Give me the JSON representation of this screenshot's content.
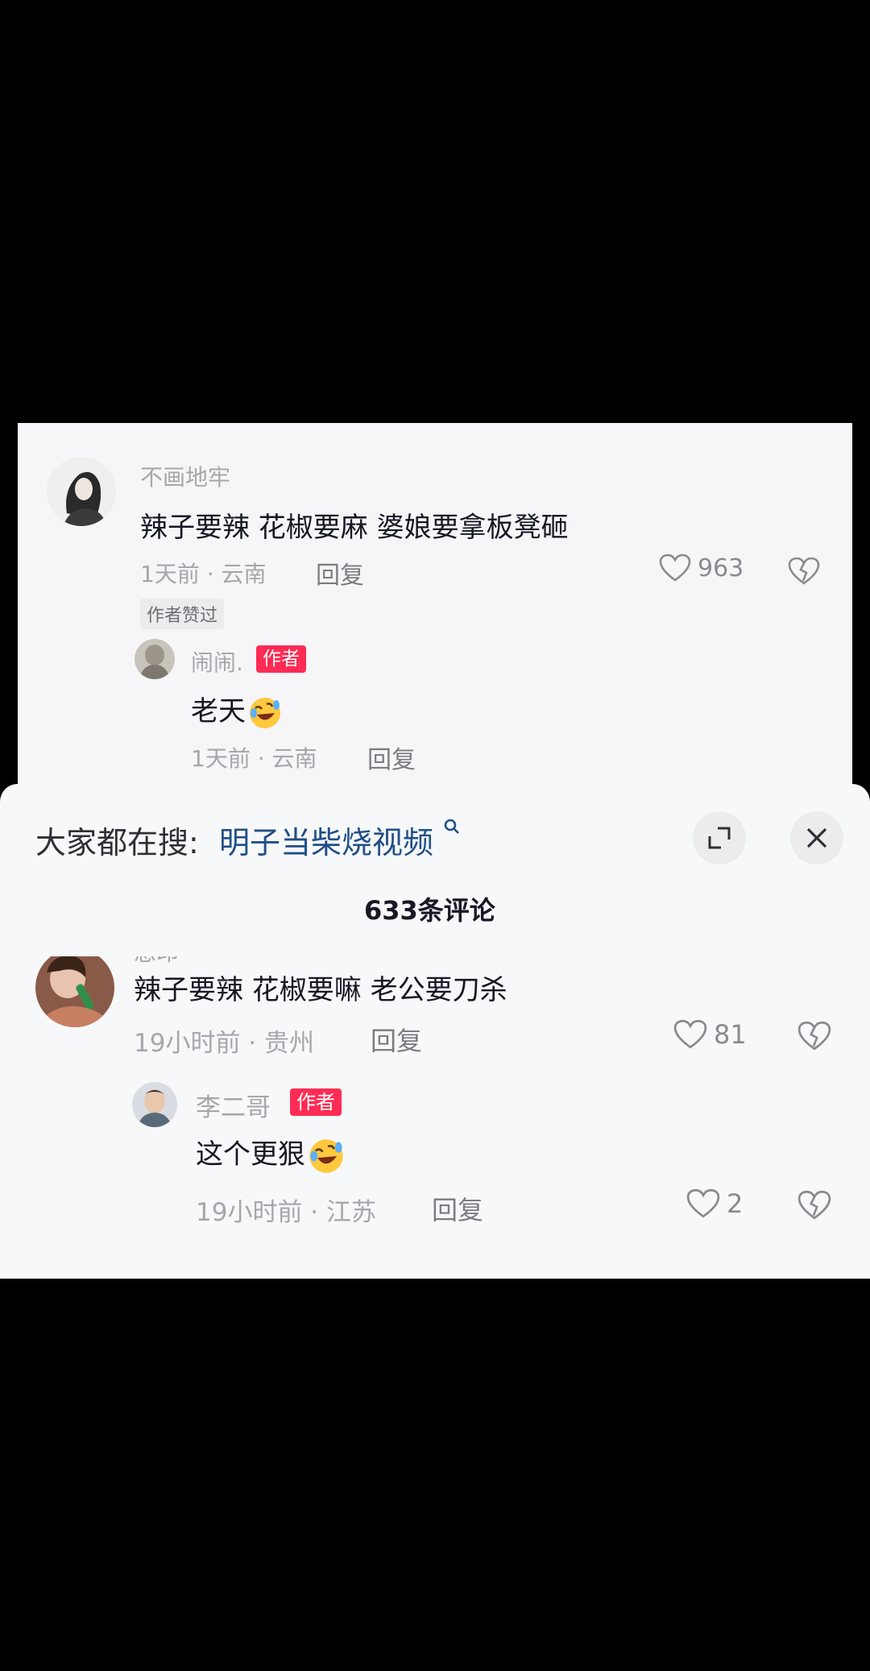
{
  "top_thread": {
    "comment": {
      "username": "不画地牢",
      "text": "辣子要辣  花椒要麻 婆娘要拿板凳砸",
      "meta": "1天前 · 云南",
      "reply_label": "回复",
      "likes": "963",
      "badge": "作者赞过"
    },
    "reply": {
      "username": "闹闹.",
      "author_tag": "作者",
      "text": "老天",
      "meta": "1天前 · 云南",
      "reply_label": "回复"
    }
  },
  "sheet": {
    "search_prefix": "大家都在搜:",
    "search_term": "明子当柴烧视频",
    "comment_count_title": "633条评论",
    "partial_username": "慈印",
    "comment": {
      "text": "辣子要辣 花椒要嘛  老公要刀杀",
      "meta": "19小时前 · 贵州",
      "reply_label": "回复",
      "likes": "81"
    },
    "reply": {
      "username": "李二哥",
      "author_tag": "作者",
      "text": "这个更狠",
      "meta": "19小时前 · 江苏",
      "reply_label": "回复",
      "likes": "2"
    }
  },
  "icons": {
    "like": "heart-outline-icon",
    "dislike": "broken-heart-icon",
    "emoji": "rofl-emoji-icon",
    "expand": "expand-icon",
    "close": "close-icon",
    "search": "search-icon"
  },
  "colors": {
    "author_tag": "#fe2c55",
    "search_link": "#1f4f86",
    "sheet_bg": "#f7f8fa"
  }
}
